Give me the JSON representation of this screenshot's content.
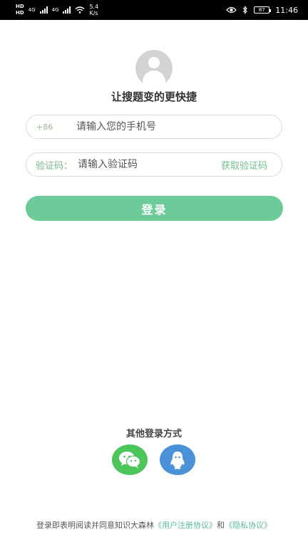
{
  "status_bar": {
    "hd1": "HD",
    "hd2": "HD",
    "net1": "4G",
    "net2": "4G",
    "speed_value": "5.4",
    "speed_unit": "K/s",
    "battery": "87",
    "time": "11:46"
  },
  "header": {
    "subtitle": "让搜题变的更快捷"
  },
  "phone_field": {
    "prefix": "+86",
    "placeholder": "请输入您的手机号"
  },
  "code_field": {
    "label": "验证码：",
    "placeholder": "请输入验证码",
    "get_code": "获取验证码"
  },
  "login_button": "登录",
  "other_login": {
    "title": "其他登录方式",
    "icons": [
      "wechat-icon",
      "qq-icon"
    ]
  },
  "agreement": {
    "prefix": "登录即表明阅读并同意知识大森林",
    "user_agreement": "《用户注册协议》",
    "joiner": "和",
    "privacy": "《隐私协议》"
  },
  "colors": {
    "accent": "#6dcb9a",
    "wechat": "#4cc55b",
    "qq": "#4a91d8",
    "link": "#5ab99b"
  }
}
